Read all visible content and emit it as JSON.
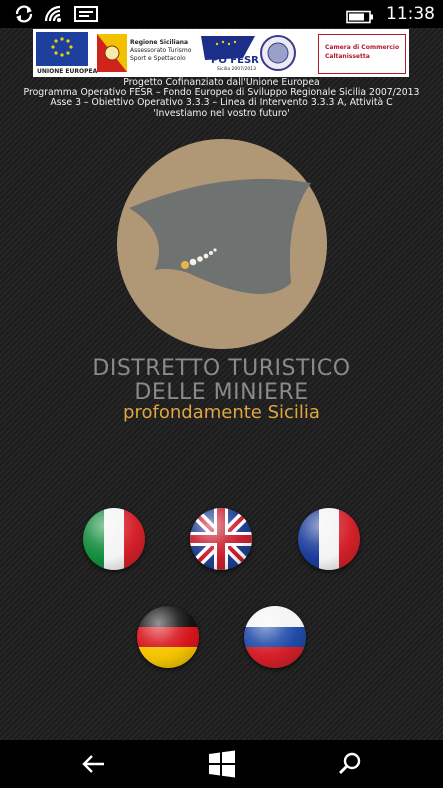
{
  "status_bar": {
    "time": "11:38",
    "icons": [
      "sync-icon",
      "wifi-icon",
      "message-icon",
      "battery-icon"
    ]
  },
  "banner": {
    "eu_label": "UNIONE EUROPEA",
    "region_line1": "Regione Siciliana",
    "region_line2": "Assessorato Turismo",
    "region_line3": "Sport e Spettacolo",
    "po_fesr": "PO FESR",
    "po_fesr_sub": "Sicilia 2007/2013",
    "chamber_line1": "Camera di Commercio",
    "chamber_line2": "Caltanissetta"
  },
  "funding": {
    "line1": "Progetto Cofinanziato dall'Unione Europea",
    "line2": "Programma Operativo FESR – Fondo Europeo di Sviluppo Regionale Sicilia 2007/2013",
    "line3": "Asse 3 – Obiettivo Operativo 3.3.3 – Linea di Intervento  3.3.3 A, Attività C",
    "line4": "'Investiamo nel vostro futuro'"
  },
  "brand": {
    "title_line1": "DISTRETTO TURISTICO",
    "title_line2": "DELLE MINIERE",
    "subtitle": "profondamente Sicilia"
  },
  "languages": [
    "italian",
    "english",
    "french",
    "german",
    "russian"
  ],
  "colors": {
    "emblem_disc": "#b09877",
    "emblem_shape": "#6e7271",
    "subtitle": "#e0a640",
    "title": "#8a8a8a"
  },
  "nav": {
    "icons": [
      "back-arrow-icon",
      "windows-start-icon",
      "search-icon"
    ]
  }
}
